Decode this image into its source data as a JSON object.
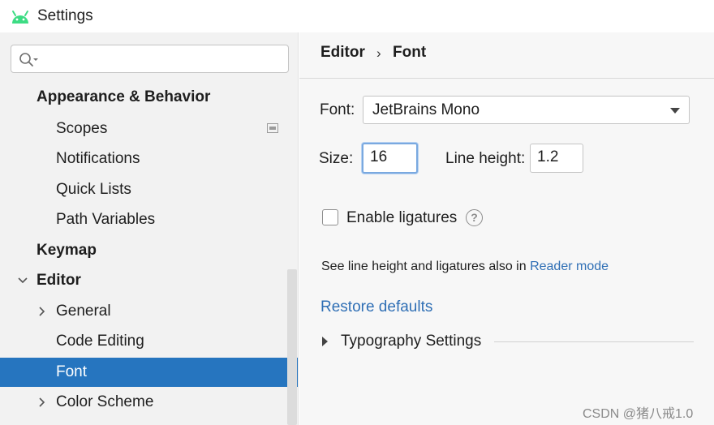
{
  "window": {
    "title": "Settings"
  },
  "search": {
    "value": "",
    "placeholder": ""
  },
  "sidebar": {
    "items": [
      {
        "label": "Appearance & Behavior"
      },
      {
        "label": "Scopes"
      },
      {
        "label": "Notifications"
      },
      {
        "label": "Quick Lists"
      },
      {
        "label": "Path Variables"
      },
      {
        "label": "Keymap"
      },
      {
        "label": "Editor"
      },
      {
        "label": "General"
      },
      {
        "label": "Code Editing"
      },
      {
        "label": "Font"
      },
      {
        "label": "Color Scheme"
      }
    ],
    "selected": "Font"
  },
  "breadcrumb": {
    "parent": "Editor",
    "separator": "›",
    "current": "Font"
  },
  "font_settings": {
    "font_label": "Font:",
    "font_value": "JetBrains Mono",
    "size_label": "Size:",
    "size_value": "16",
    "line_height_label": "Line height:",
    "line_height_value": "1.2",
    "ligatures_label": "Enable ligatures",
    "ligatures_checked": false,
    "help_symbol": "?",
    "info_text": "See line height and ligatures also in",
    "info_link": "Reader mode",
    "restore_label": "Restore defaults",
    "typography_label": "Typography Settings"
  },
  "colors": {
    "selection": "#2675bf",
    "link": "#2f6fb5",
    "android_green": "#3ddc84"
  },
  "watermark": "CSDN @猪八戒1.0"
}
